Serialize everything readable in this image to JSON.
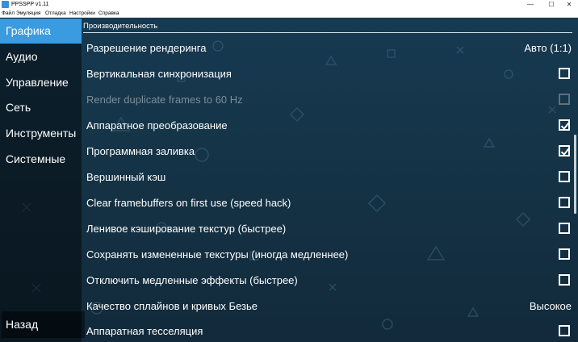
{
  "window": {
    "title": "PPSSPP v1.11",
    "controls": {
      "minimize": "—",
      "maximize": "☐",
      "close": "✕"
    }
  },
  "menu": [
    "Файл",
    "Эмуляция",
    "Отладка",
    "Настройки",
    "Справка"
  ],
  "sidebar": {
    "items": [
      {
        "label": "Графика",
        "active": true
      },
      {
        "label": "Аудио",
        "active": false
      },
      {
        "label": "Управление",
        "active": false
      },
      {
        "label": "Сеть",
        "active": false
      },
      {
        "label": "Инструменты",
        "active": false
      },
      {
        "label": "Системные",
        "active": false
      }
    ],
    "back_label": "Назад"
  },
  "main": {
    "section_title": "Производительность",
    "rows": [
      {
        "label": "Разрешение рендеринга",
        "type": "value",
        "value": "Авто (1:1)"
      },
      {
        "label": "Вертикальная синхронизация",
        "type": "checkbox",
        "checked": false
      },
      {
        "label": "Render duplicate frames to 60 Hz",
        "type": "checkbox",
        "checked": false,
        "disabled": true
      },
      {
        "label": "Аппаратное преобразование",
        "type": "checkbox",
        "checked": true
      },
      {
        "label": "Программная заливка",
        "type": "checkbox",
        "checked": true
      },
      {
        "label": "Вершинный кэш",
        "type": "checkbox",
        "checked": false
      },
      {
        "label": "Clear framebuffers on first use (speed hack)",
        "type": "checkbox",
        "checked": false
      },
      {
        "label": "Ленивое кэширование текстур (быстрее)",
        "type": "checkbox",
        "checked": false
      },
      {
        "label": "Сохранять измененные текстуры (иногда медленнее)",
        "type": "checkbox",
        "checked": false
      },
      {
        "label": "Отключить медленные эффекты (быстрее)",
        "type": "checkbox",
        "checked": false
      },
      {
        "label": "Качество сплайнов и кривых Безье",
        "type": "value",
        "value": "Высокое"
      },
      {
        "label": "Аппаратная тесселяция",
        "type": "checkbox",
        "checked": false
      }
    ]
  },
  "colors": {
    "accent": "#3a9be0",
    "background": "#173446",
    "text": "#ffffff",
    "disabled_text": "#7d8d96"
  }
}
